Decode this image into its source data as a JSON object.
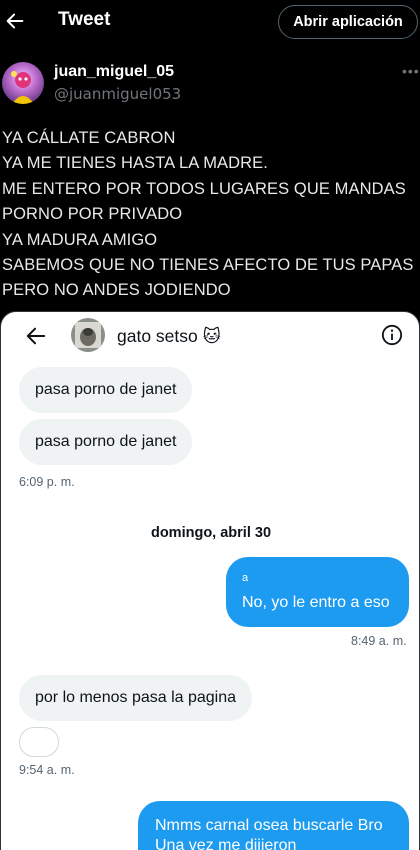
{
  "header": {
    "title": "Tweet",
    "open_app_label": "Abrir aplicación"
  },
  "author": {
    "name": "juan_miguel_05",
    "handle": "@juanmiguel053",
    "more": "•••"
  },
  "tweet_lines": [
    "YA CÁLLATE CABRON",
    "YA ME TIENES HASTA LA MADRE.",
    "ME ENTERO POR TODOS LUGARES QUE MANDAS",
    "PORNO POR PRIVADO",
    "YA MADURA AMIGO",
    "SABEMOS QUE NO TIENES AFECTO DE TUS PAPAS",
    "PERO NO ANDES JODIENDO"
  ],
  "chat": {
    "contact_name": "gato setso 🐱",
    "messages": {
      "in_1": "pasa porno de janet",
      "in_2": "pasa porno de janet",
      "time_1": "6:09 p. m.",
      "date_separator": "domingo, abril 30",
      "out_reply_label": "a",
      "out_1": "No, yo le entro a eso",
      "time_2": "8:49 a. m.",
      "in_3": "por lo menos pasa la pagina",
      "emoji": "😂",
      "time_3": "9:54 a. m.",
      "out_2_line1": "Nmms carnal osea buscarle Bro",
      "out_2_line2": "Una vez me dijieron"
    }
  },
  "colors": {
    "background": "#000000",
    "accent": "#1d9bf0",
    "muted": "#71767b",
    "bubble_in": "#eff3f4"
  }
}
